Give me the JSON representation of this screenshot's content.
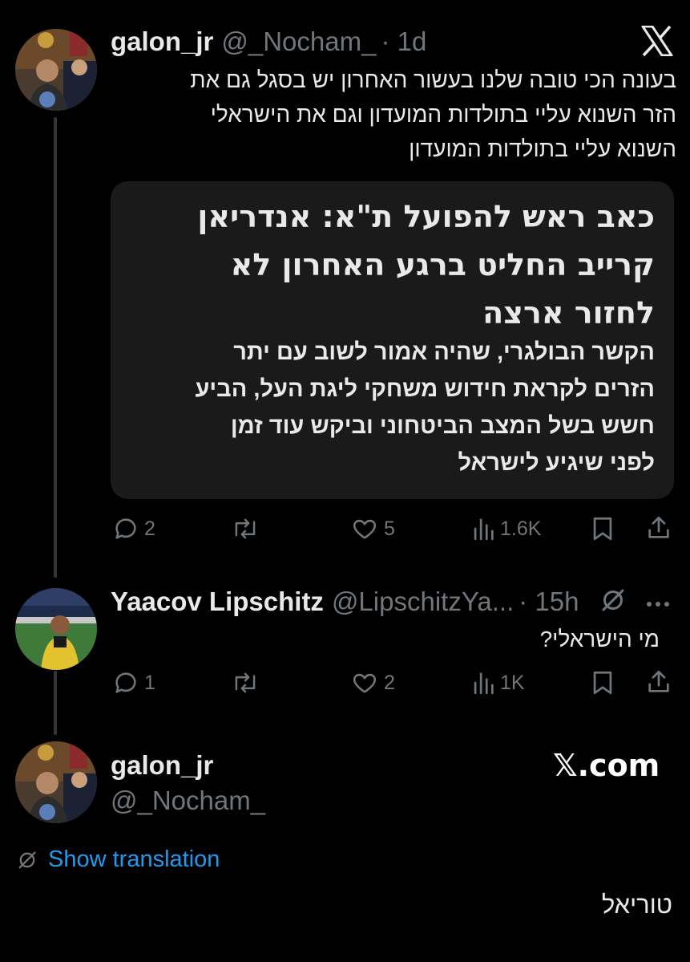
{
  "tweet1": {
    "name": "galon_jr",
    "handle": "@_Nocham_",
    "time": "· 1d",
    "text_lines": [
      "בעונה הכי טובה שלנו בעשור האחרון יש בסגל גם את",
      "הזר השנוא עליי בתולדות המועדון וגם את הישראלי",
      "השנוא עליי בתולדות המועדון"
    ],
    "card": {
      "headline_lines": [
        "כאב ראש להפועל ת\"א: אנדריאן",
        "קרייב החליט ברגע האחרון לא",
        "לחזור ארצה"
      ],
      "body_lines": [
        "הקשר הבולגרי, שהיה אמור לשוב עם יתר",
        "הזרים לקראת חידוש משחקי ליגת העל, הביע",
        "חשש בשל המצב הביטחוני וביקש עוד זמן",
        "לפני שיגיע לישראל"
      ]
    },
    "actions": {
      "replies": "2",
      "reposts": "",
      "likes": "5",
      "views": "1.6K"
    }
  },
  "tweet2": {
    "name": "Yaacov Lipschitz",
    "handle": "@LipschitzYa...",
    "time": "· 15h",
    "text": "מי הישראלי?",
    "actions": {
      "replies": "1",
      "reposts": "",
      "likes": "2",
      "views": "1K"
    }
  },
  "tweet3": {
    "name": "galon_jr",
    "handle": "@_Nocham_",
    "brand": "𝕏.com",
    "show_translation": "Show translation",
    "text": "טוריאל"
  },
  "icons": {
    "x_logo": "x-logo-icon",
    "reply": "reply-icon",
    "repost": "repost-icon",
    "like": "heart-icon",
    "views": "views-icon",
    "bookmark": "bookmark-icon",
    "share": "share-icon"
  },
  "colors": {
    "background": "#000000",
    "text": "#e7e9ea",
    "muted": "#71767b",
    "link": "#1d9bf0",
    "card": "#1a1a1a"
  }
}
